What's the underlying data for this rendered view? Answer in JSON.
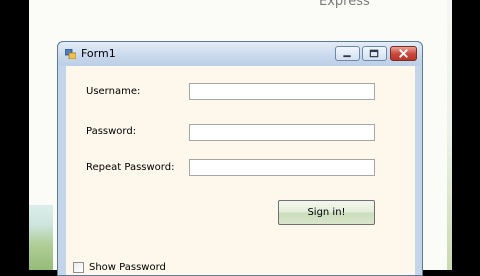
{
  "background": {
    "text": "Express"
  },
  "window": {
    "title": "Form1",
    "controls": {
      "minimize": "minimize",
      "maximize": "maximize",
      "close": "close"
    }
  },
  "form": {
    "username_label": "Username:",
    "username_value": "",
    "password_label": "Password:",
    "password_value": "",
    "repeat_label": "Repeat Password:",
    "repeat_value": "",
    "signin_label": "Sign in!",
    "show_password_label": "Show Password",
    "show_password_checked": false
  },
  "icons": [
    "form-app-icon",
    "minimize-icon",
    "maximize-icon",
    "close-icon"
  ],
  "colors": {
    "close_button": "#c9463a",
    "titlebar": "#c8d8ec",
    "client": "#fdf8eb"
  }
}
